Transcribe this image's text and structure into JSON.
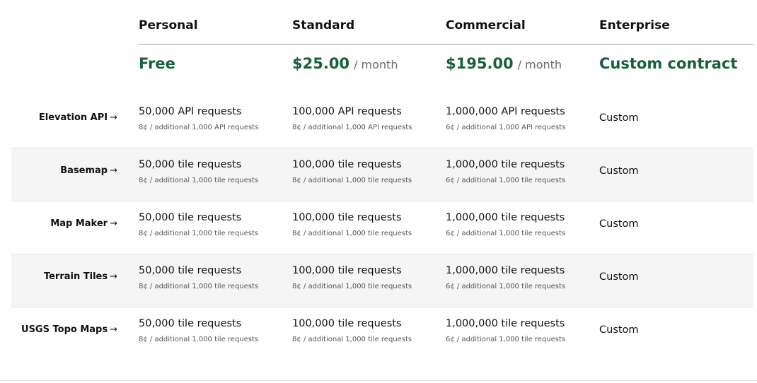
{
  "plans": [
    {
      "name": "Personal",
      "price": "Free",
      "period": ""
    },
    {
      "name": "Standard",
      "price": "$25.00",
      "period": "/ month"
    },
    {
      "name": "Commercial",
      "price": "$195.00",
      "period": "/ month"
    },
    {
      "name": "Enterprise",
      "price": "Custom contract",
      "period": ""
    }
  ],
  "arrow": "→",
  "features": [
    {
      "name": "Elevation API",
      "cells": [
        {
          "main": "50,000 API requests",
          "sub": "8¢ / additional 1,000 API requests"
        },
        {
          "main": "100,000 API requests",
          "sub": "8¢ / additional 1,000 API requests"
        },
        {
          "main": "1,000,000 API requests",
          "sub": "6¢ / additional 1,000 API requests"
        }
      ],
      "enterprise": "Custom"
    },
    {
      "name": "Basemap",
      "cells": [
        {
          "main": "50,000 tile requests",
          "sub": "8¢ / additional 1,000 tile requests"
        },
        {
          "main": "100,000 tile requests",
          "sub": "8¢ / additional 1,000 tile requests"
        },
        {
          "main": "1,000,000 tile requests",
          "sub": "6¢ / additional 1,000 tile requests"
        }
      ],
      "enterprise": "Custom"
    },
    {
      "name": "Map Maker",
      "cells": [
        {
          "main": "50,000 tile requests",
          "sub": "8¢ / additional 1,000 tile requests"
        },
        {
          "main": "100,000 tile requests",
          "sub": "8¢ / additional 1,000 tile requests"
        },
        {
          "main": "1,000,000 tile requests",
          "sub": "6¢ / additional 1,000 tile requests"
        }
      ],
      "enterprise": "Custom"
    },
    {
      "name": "Terrain Tiles",
      "cells": [
        {
          "main": "50,000 tile requests",
          "sub": "8¢ / additional 1,000 tile requests"
        },
        {
          "main": "100,000 tile requests",
          "sub": "8¢ / additional 1,000 tile requests"
        },
        {
          "main": "1,000,000 tile requests",
          "sub": "6¢ / additional 1,000 tile requests"
        }
      ],
      "enterprise": "Custom"
    },
    {
      "name": "USGS Topo Maps",
      "cells": [
        {
          "main": "50,000 tile requests",
          "sub": "8¢ / additional 1,000 tile requests"
        },
        {
          "main": "100,000 tile requests",
          "sub": "8¢ / additional 1,000 tile requests"
        },
        {
          "main": "1,000,000 tile requests",
          "sub": "6¢ / additional 1,000 tile requests"
        }
      ],
      "enterprise": "Custom"
    }
  ],
  "colors": {
    "price_green": "#17613a",
    "row_shade": "#f5f5f5"
  }
}
